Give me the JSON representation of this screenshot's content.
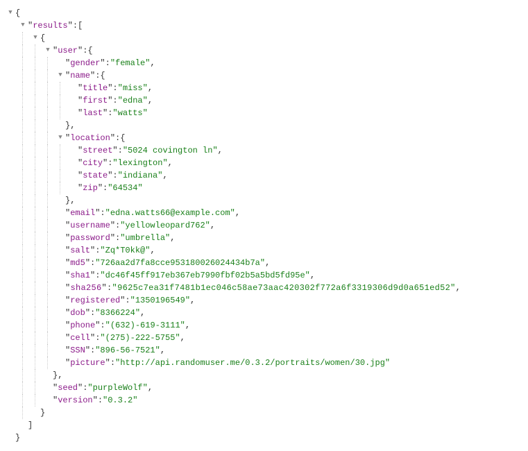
{
  "root": {
    "resultsKey": "results",
    "userKey": "user",
    "user": {
      "gender": {
        "k": "gender",
        "v": "female"
      },
      "nameKey": "name",
      "name": {
        "title": {
          "k": "title",
          "v": "miss"
        },
        "first": {
          "k": "first",
          "v": "edna"
        },
        "last": {
          "k": "last",
          "v": "watts"
        }
      },
      "locationKey": "location",
      "location": {
        "street": {
          "k": "street",
          "v": "5024 covington ln"
        },
        "city": {
          "k": "city",
          "v": "lexington"
        },
        "state": {
          "k": "state",
          "v": "indiana"
        },
        "zip": {
          "k": "zip",
          "v": "64534"
        }
      },
      "email": {
        "k": "email",
        "v": "edna.watts66@example.com"
      },
      "username": {
        "k": "username",
        "v": "yellowleopard762"
      },
      "password": {
        "k": "password",
        "v": "umbrella"
      },
      "salt": {
        "k": "salt",
        "v": "Zq*T0kk@"
      },
      "md5": {
        "k": "md5",
        "v": "726aa2d7fa8cce953180026024434b7a"
      },
      "sha1": {
        "k": "sha1",
        "v": "dc46f45ff917eb367eb7990fbf02b5a5bd5fd95e"
      },
      "sha256": {
        "k": "sha256",
        "v": "9625c7ea31f7481b1ec046c58ae73aac420302f772a6f3319306d9d0a651ed52"
      },
      "registered": {
        "k": "registered",
        "v": "1350196549"
      },
      "dob": {
        "k": "dob",
        "v": "8366224"
      },
      "phone": {
        "k": "phone",
        "v": "(632)-619-3111"
      },
      "cell": {
        "k": "cell",
        "v": "(275)-222-5755"
      },
      "SSN": {
        "k": "SSN",
        "v": "896-56-7521"
      },
      "picture": {
        "k": "picture",
        "v": "http://api.randomuser.me/0.3.2/portraits/women/30.jpg"
      }
    },
    "seed": {
      "k": "seed",
      "v": "purpleWolf"
    },
    "version": {
      "k": "version",
      "v": "0.3.2"
    }
  },
  "symbols": {
    "toggleOpen": "▼",
    "openBrace": "{",
    "closeBrace": "}",
    "closeBraceComma": "},",
    "openBracket": "[",
    "closeBracket": "]",
    "colon": ":",
    "comma": ",",
    "quote": "\""
  }
}
